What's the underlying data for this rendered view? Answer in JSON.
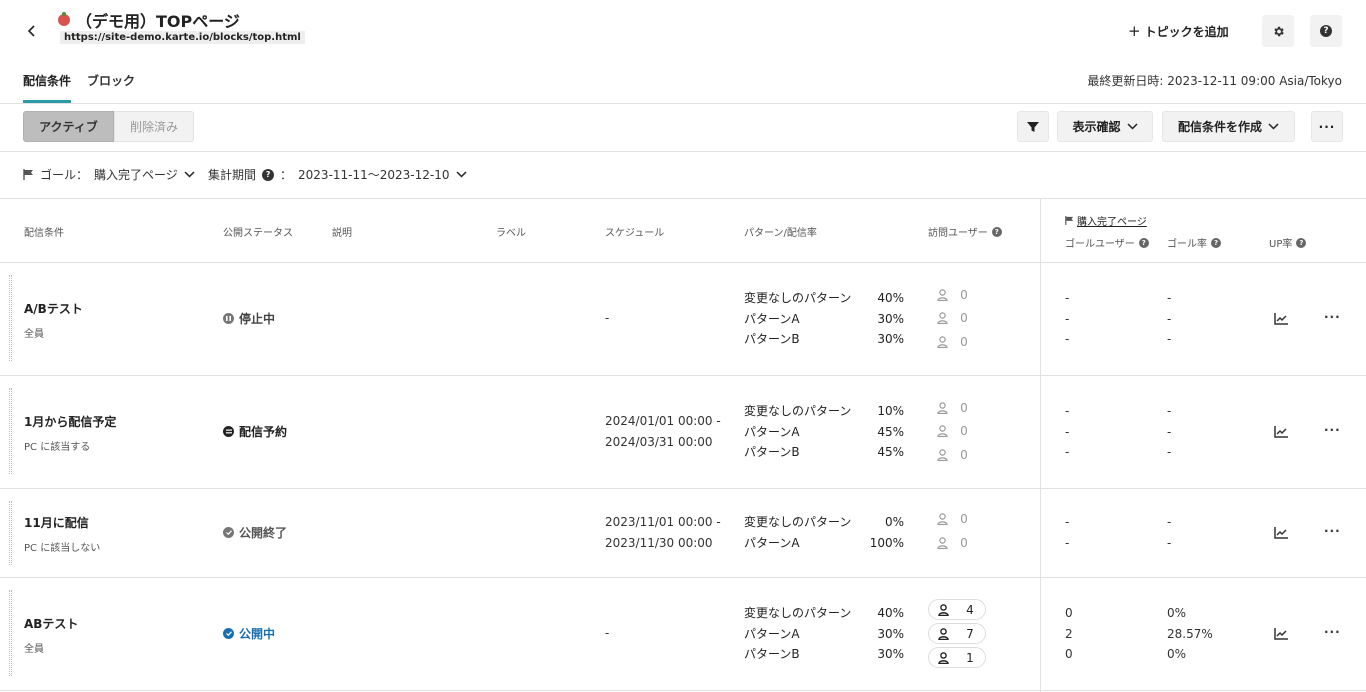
{
  "header": {
    "title": "（デモ用）TOPページ",
    "url": "https://site-demo.karte.io/blocks/top.html",
    "add_topic_label": "トピックを追加"
  },
  "tabs": [
    {
      "label": "配信条件",
      "active": true
    },
    {
      "label": "ブロック",
      "active": false
    }
  ],
  "last_updated": "最終更新日時: 2023-12-11 09:00 Asia/Tokyo",
  "toolbar": {
    "active_label": "アクティブ",
    "deleted_label": "削除済み",
    "view_label": "表示確認",
    "create_label": "配信条件を作成"
  },
  "filters": {
    "goal_label": "ゴール：",
    "goal_value": "購入完了ページ",
    "period_label": "集計期間",
    "period_sep": "：",
    "period_value": "2023-11-11〜2023-12-10"
  },
  "columns": {
    "condition": "配信条件",
    "status": "公開ステータス",
    "description": "説明",
    "label": "ラベル",
    "schedule": "スケジュール",
    "pattern": "パターン/配信率",
    "visitors": "訪問ユーザー",
    "goal_page": "購入完了ページ",
    "goal_users": "ゴールユーザー",
    "goal_rate": "ゴール率",
    "up_rate": "UP率"
  },
  "colors": {
    "accent": "#2a9ca6",
    "published": "#1a6fb0",
    "muted": "#777777"
  },
  "rows": [
    {
      "name": "A/Bテスト",
      "sub": "全員",
      "status": "停止中",
      "status_icon": "pause-icon",
      "schedule_1": "-",
      "schedule_2": "",
      "patterns": [
        {
          "name": "変更なしのパターン",
          "rate": "40%",
          "visitors": "0",
          "goal_users": "-",
          "goal_rate": "-"
        },
        {
          "name": "パターンA",
          "rate": "30%",
          "visitors": "0",
          "goal_users": "-",
          "goal_rate": "-"
        },
        {
          "name": "パターンB",
          "rate": "30%",
          "visitors": "0",
          "goal_users": "-",
          "goal_rate": "-"
        }
      ]
    },
    {
      "name": "1月から配信予定",
      "sub": "PC に該当する",
      "status": "配信予約",
      "status_icon": "calendar-icon",
      "schedule_1": "2024/01/01 00:00 -",
      "schedule_2": "2024/03/31 00:00",
      "patterns": [
        {
          "name": "変更なしのパターン",
          "rate": "10%",
          "visitors": "0",
          "goal_users": "-",
          "goal_rate": "-"
        },
        {
          "name": "パターンA",
          "rate": "45%",
          "visitors": "0",
          "goal_users": "-",
          "goal_rate": "-"
        },
        {
          "name": "パターンB",
          "rate": "45%",
          "visitors": "0",
          "goal_users": "-",
          "goal_rate": "-"
        }
      ]
    },
    {
      "name": "11月に配信",
      "sub": "PC に該当しない",
      "status": "公開終了",
      "status_icon": "check-circle-icon",
      "schedule_1": "2023/11/01 00:00 -",
      "schedule_2": "2023/11/30 00:00",
      "patterns": [
        {
          "name": "変更なしのパターン",
          "rate": "0%",
          "visitors": "0",
          "goal_users": "-",
          "goal_rate": "-"
        },
        {
          "name": "パターンA",
          "rate": "100%",
          "visitors": "0",
          "goal_users": "-",
          "goal_rate": "-"
        }
      ]
    },
    {
      "name": "ABテスト",
      "sub": "全員",
      "status": "公開中",
      "status_icon": "check-circle-icon",
      "schedule_1": "-",
      "schedule_2": "",
      "patterns": [
        {
          "name": "変更なしのパターン",
          "rate": "40%",
          "visitors": "4",
          "goal_users": "0",
          "goal_rate": "0%"
        },
        {
          "name": "パターンA",
          "rate": "30%",
          "visitors": "7",
          "goal_users": "2",
          "goal_rate": "28.57%"
        },
        {
          "name": "パターンB",
          "rate": "30%",
          "visitors": "1",
          "goal_users": "0",
          "goal_rate": "0%"
        }
      ]
    }
  ]
}
